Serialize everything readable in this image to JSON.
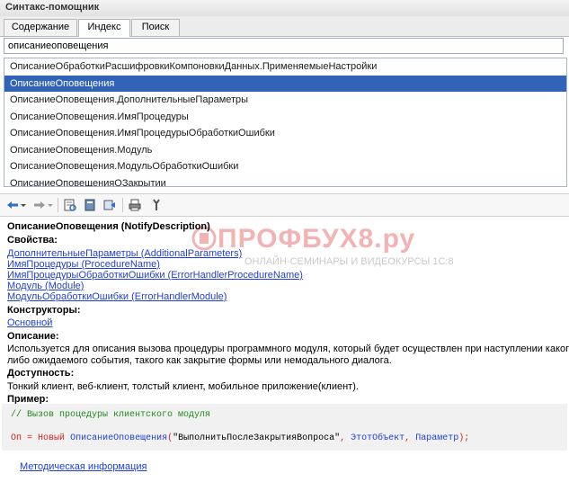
{
  "window": {
    "title": "Синтакс-помощник"
  },
  "tabs": [
    {
      "label": "Содержание"
    },
    {
      "label": "Индекс"
    },
    {
      "label": "Поиск"
    }
  ],
  "search": {
    "value": "описаниеоповещения"
  },
  "list": {
    "items": [
      "ОписаниеОбработкиРасшифровкиКомпоновкиДанных.ПрименяемыеНастройки",
      "ОписаниеОповещения",
      "ОписаниеОповещения.ДополнительныеПараметры",
      "ОписаниеОповещения.ИмяПроцедуры",
      "ОписаниеОповещения.ИмяПроцедурыОбработкиОшибки",
      "ОписаниеОповещения.Модуль",
      "ОписаниеОповещения.МодульОбработкиОшибки",
      "ОписаниеОповещенияОЗакрытии"
    ],
    "selected_index": 1
  },
  "toolbar": {
    "icons": [
      "back-arrow-icon",
      "dropdown-icon",
      "forward-arrow-icon",
      "dropdown-icon",
      "find-in-list-icon",
      "book-icon",
      "tree-sync-icon",
      "print-icon",
      "settings-icon"
    ]
  },
  "watermark": {
    "brand": "ПРОФБУХ8.ру",
    "tagline": "ОНЛАЙН-СЕМИНАРЫ И ВИДЕОКУРСЫ 1С:8"
  },
  "doc": {
    "title": "ОписаниеОповещения (NotifyDescription)",
    "properties_heading": "Свойства:",
    "properties": [
      "ДополнительныеПараметры (AdditionalParameters)",
      "ИмяПроцедуры (ProcedureName)",
      "ИмяПроцедурыОбработкиОшибки (ErrorHandlerProcedureName)",
      "Модуль (Module)",
      "МодульОбработкиОшибки (ErrorHandlerModule)"
    ],
    "constructors_heading": "Конструкторы:",
    "constructor": "Основной",
    "description_heading": "Описание:",
    "description_line1": "Используется для описания вызова процедуры программного модуля, который будет осуществлен при наступлении какого-",
    "description_line2": "либо ожидаемого события, такого как закрытие формы или немодального диалога.",
    "availability_heading": "Доступность:",
    "availability": "Тонкий клиент, веб-клиент, толстый клиент, мобильное приложение(клиент).",
    "example_heading": "Пример:",
    "code": {
      "comment": "// Вызов процедуры клиентского модуля",
      "var": "Оп",
      "eq": " = ",
      "new_kw": "Новый",
      "type": "ОписаниеОповещения",
      "open": "(",
      "arg1": "\"ВыполнитьПослеЗакрытияВопроса\"",
      "comma1": ", ",
      "arg2": "ЭтотОбъект",
      "comma2": ", ",
      "arg3": "Параметр",
      "close": ");"
    },
    "footer_link": "Методическая информация"
  },
  "colors": {
    "selection": "#3163b6",
    "link": "#1f3fd6",
    "comment": "#1f8a1f",
    "keyword": "#d12020"
  }
}
